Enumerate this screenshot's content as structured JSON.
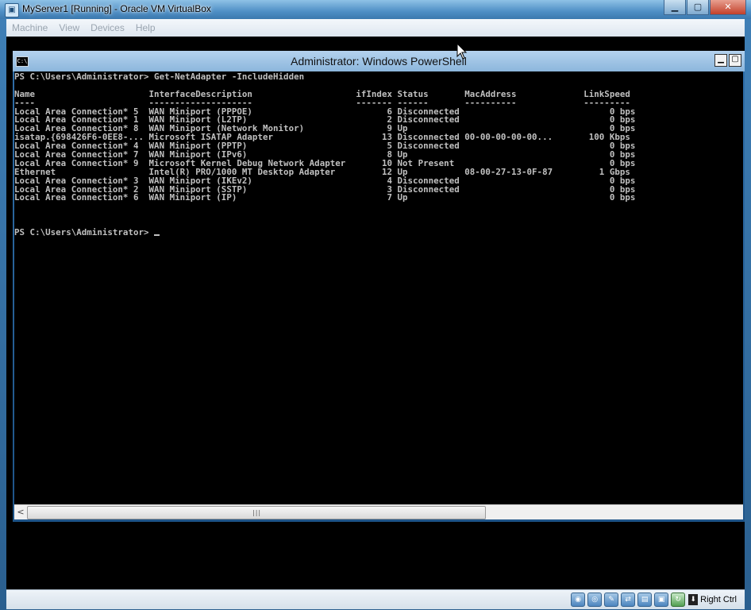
{
  "vbox": {
    "title": "MyServer1 [Running] - Oracle VM VirtualBox",
    "menu": [
      "Machine",
      "View",
      "Devices",
      "Help"
    ],
    "controls": {
      "minimize": "▁",
      "maximize": "▢",
      "close": "✕"
    },
    "host_key": "Right Ctrl",
    "status_icons": [
      "hard-disk-icon",
      "optical-drive-icon",
      "usb-icon",
      "network-icon",
      "shared-folders-icon",
      "display-icon",
      "capture-icon"
    ]
  },
  "powershell": {
    "title": "Administrator: Windows PowerShell",
    "lines": [
      "PS C:\\Users\\Administrator> Get-NetAdapter -IncludeHidden",
      "",
      "Name                      InterfaceDescription                    ifIndex Status       MacAddress             LinkSpeed",
      "----                      --------------------                    ------- ------       ----------             ---------",
      "Local Area Connection* 5  WAN Miniport (PPPOE)                          6 Disconnected                             0 bps",
      "Local Area Connection* 1  WAN Miniport (L2TP)                           2 Disconnected                             0 bps",
      "Local Area Connection* 8  WAN Miniport (Network Monitor)                9 Up                                       0 bps",
      "isatap.{698426F6-0EE8-... Microsoft ISATAP Adapter                     13 Disconnected 00-00-00-00-00...       100 Kbps",
      "Local Area Connection* 4  WAN Miniport (PPTP)                           5 Disconnected                             0 bps",
      "Local Area Connection* 7  WAN Miniport (IPv6)                           8 Up                                       0 bps",
      "Local Area Connection* 9  Microsoft Kernel Debug Network Adapter       10 Not Present                              0 bps",
      "Ethernet                  Intel(R) PRO/1000 MT Desktop Adapter         12 Up           08-00-27-13-0F-87         1 Gbps",
      "Local Area Connection* 3  WAN Miniport (IKEv2)                          4 Disconnected                             0 bps",
      "Local Area Connection* 2  WAN Miniport (SSTP)                           3 Disconnected                             0 bps",
      "Local Area Connection* 6  WAN Miniport (IP)                             7 Up                                       0 bps",
      "",
      ""
    ],
    "prompt": "PS C:\\Users\\Administrator> ",
    "scroll_grip": "|||",
    "scroll_left": "<"
  },
  "colors": {
    "console_bg": "#000000",
    "console_fg": "#c0c0c0"
  }
}
